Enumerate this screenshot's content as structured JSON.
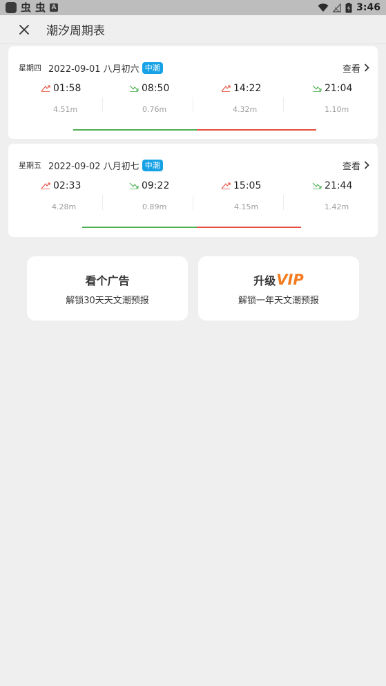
{
  "status_bar": {
    "glyph_1": "虫",
    "glyph_2": "虫",
    "a_icon": "A",
    "time": "3:46"
  },
  "header": {
    "title": "潮汐周期表"
  },
  "days": [
    {
      "weekday": "星期四",
      "date": "2022-09-01 八月初六",
      "badge": "中潮",
      "view_label": "查看",
      "tides": [
        {
          "type": "high",
          "time": "01:58",
          "height": "4.51m"
        },
        {
          "type": "low",
          "time": "08:50",
          "height": "0.76m"
        },
        {
          "type": "high",
          "time": "14:22",
          "height": "4.32m"
        },
        {
          "type": "low",
          "time": "21:04",
          "height": "1.10m"
        }
      ]
    },
    {
      "weekday": "星期五",
      "date": "2022-09-02 八月初七",
      "badge": "中潮",
      "view_label": "查看",
      "tides": [
        {
          "type": "high",
          "time": "02:33",
          "height": "4.28m"
        },
        {
          "type": "low",
          "time": "09:22",
          "height": "0.89m"
        },
        {
          "type": "high",
          "time": "15:05",
          "height": "4.15m"
        },
        {
          "type": "low",
          "time": "21:44",
          "height": "1.42m"
        }
      ]
    }
  ],
  "actions": {
    "ad": {
      "title": "看个广告",
      "subtitle": "解锁30天天文潮预报"
    },
    "vip": {
      "title": "升级",
      "tag": "VIP",
      "subtitle": "解锁一年天文潮预报"
    }
  },
  "colors": {
    "high_tide": "#e74c3c",
    "low_tide": "#4caf50",
    "badge": "#17a2e6",
    "vip": "#f47b20"
  },
  "icons": {
    "close": "close-icon",
    "chevron": "chevron-right-icon",
    "rising": "tide-rising-icon",
    "falling": "tide-falling-icon"
  }
}
